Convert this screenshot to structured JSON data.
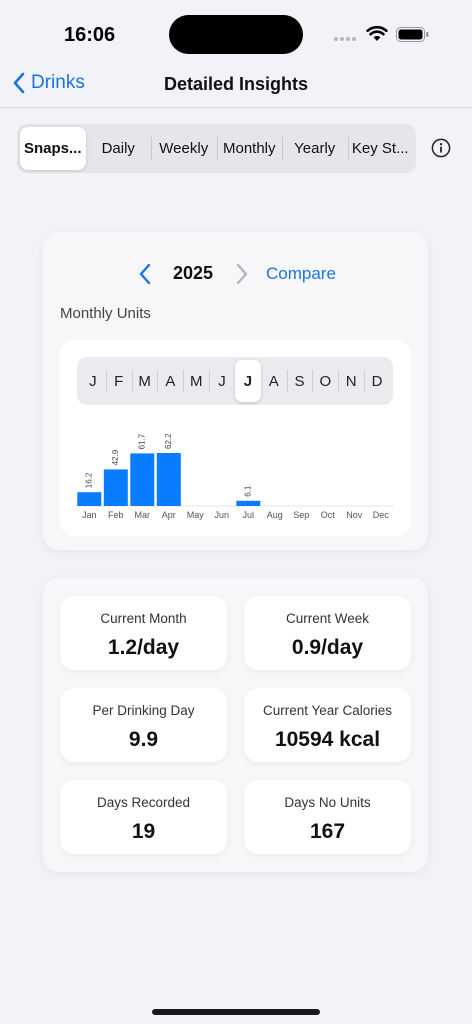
{
  "status": {
    "time": "16:06"
  },
  "nav": {
    "back_label": "Drinks",
    "title": "Detailed Insights"
  },
  "tabs": [
    {
      "label": "Snaps...",
      "active": true
    },
    {
      "label": "Daily",
      "active": false
    },
    {
      "label": "Weekly",
      "active": false
    },
    {
      "label": "Monthly",
      "active": false
    },
    {
      "label": "Yearly",
      "active": false
    },
    {
      "label": "Key St...",
      "active": false
    }
  ],
  "chart_card": {
    "year": "2025",
    "compare_label": "Compare",
    "subtitle": "Monthly Units",
    "month_picker": [
      "J",
      "F",
      "M",
      "A",
      "M",
      "J",
      "J",
      "A",
      "S",
      "O",
      "N",
      "D"
    ],
    "month_picker_selected_index": 6
  },
  "chart_data": {
    "type": "bar",
    "categories": [
      "Jan",
      "Feb",
      "Mar",
      "Apr",
      "May",
      "Jun",
      "Jul",
      "Aug",
      "Sep",
      "Oct",
      "Nov",
      "Dec"
    ],
    "values": [
      16.2,
      42.9,
      61.7,
      62.2,
      0,
      0,
      6.1,
      0,
      0,
      0,
      0,
      0
    ],
    "value_labels": [
      "16.2",
      "42.9",
      "61.7",
      "62.2",
      "",
      "",
      "6.1",
      "",
      "",
      "",
      "",
      ""
    ],
    "ylim": [
      0,
      62.2
    ],
    "bar_color": "#0a7cff",
    "grid": false,
    "legend": "none"
  },
  "stats": [
    {
      "label": "Current Month",
      "value": "1.2/day"
    },
    {
      "label": "Current Week",
      "value": "0.9/day"
    },
    {
      "label": "Per Drinking Day",
      "value": "9.9"
    },
    {
      "label": "Current Year Calories",
      "value": "10594 kcal"
    },
    {
      "label": "Days Recorded",
      "value": "19"
    },
    {
      "label": "Days No Units",
      "value": "167"
    }
  ],
  "colors": {
    "accent": "#1a73e8",
    "bar": "#0a7cff",
    "background": "#f2f3f8"
  }
}
